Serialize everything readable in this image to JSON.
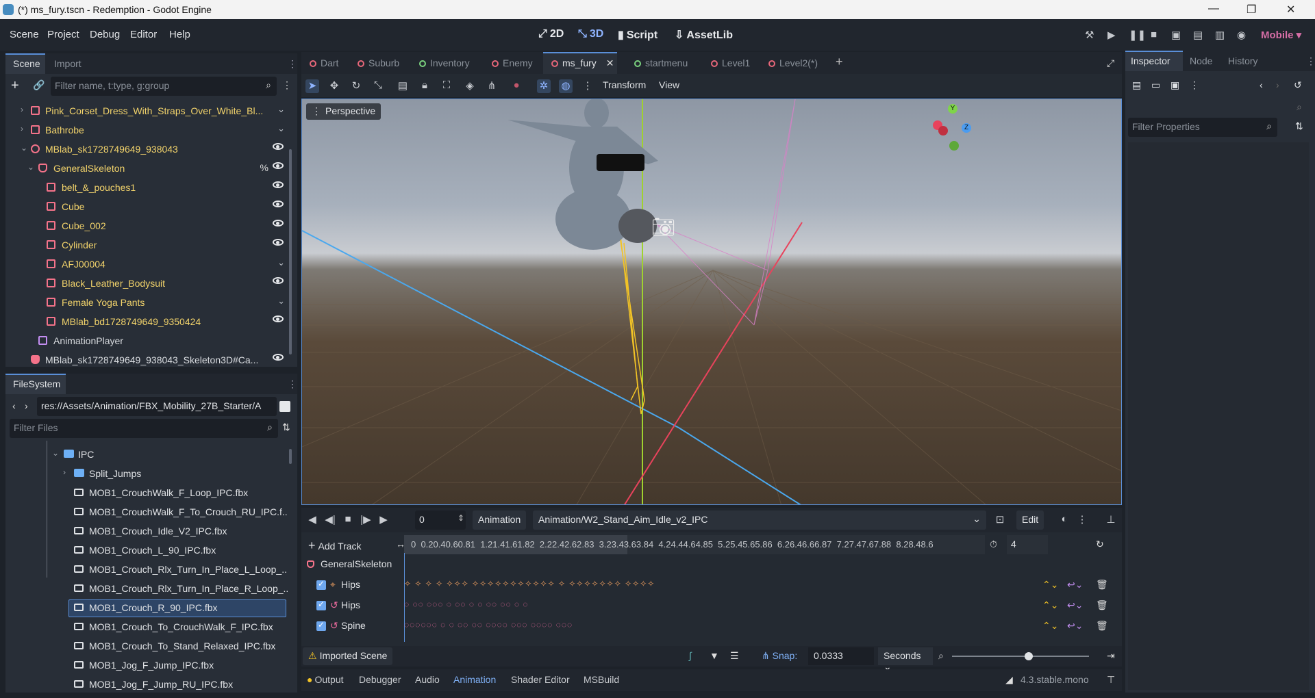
{
  "window": {
    "title": "(*) ms_fury.tscn - Redemption - Godot Engine"
  },
  "menu": {
    "items": [
      "Scene",
      "Project",
      "Debug",
      "Editor",
      "Help"
    ]
  },
  "workspaces": [
    {
      "label": "2D",
      "icon": "⤢"
    },
    {
      "label": "3D",
      "icon": "⤡"
    },
    {
      "label": "Script",
      "icon": "▮"
    },
    {
      "label": "AssetLib",
      "icon": "⇩"
    }
  ],
  "renderer": "Mobile",
  "scene_dock": {
    "tabs": [
      "Scene",
      "Import"
    ],
    "filter_placeholder": "Filter name, t:type, g:group",
    "nodes": [
      {
        "label": "Pink_Corset_Dress_With_Straps_Over_White_Bl...",
        "vis": "hidden"
      },
      {
        "label": "Bathrobe",
        "vis": "hidden"
      },
      {
        "label": "MBlab_sk1728749649_938043",
        "vis": "eye"
      },
      {
        "label": "GeneralSkeleton",
        "vis": "eye",
        "extra": "%"
      },
      {
        "label": "belt_&_pouches1",
        "vis": "eye"
      },
      {
        "label": "Cube",
        "vis": "eye"
      },
      {
        "label": "Cube_002",
        "vis": "eye"
      },
      {
        "label": "Cylinder",
        "vis": "eye"
      },
      {
        "label": "AFJ00004",
        "vis": "hidden"
      },
      {
        "label": "Black_Leather_Bodysuit",
        "vis": "eye"
      },
      {
        "label": "Female Yoga Pants",
        "vis": "hidden"
      },
      {
        "label": "MBlab_bd1728749649_9350424",
        "vis": "eye"
      },
      {
        "label": "AnimationPlayer",
        "vis": "none"
      },
      {
        "label": "MBlab_sk1728749649_938043_Skeleton3D#Ca...",
        "vis": "eye"
      }
    ]
  },
  "filesystem": {
    "tab": "FileSystem",
    "path": "res://Assets/Animation/FBX_Mobility_27B_Starter/A",
    "filter_placeholder": "Filter Files",
    "items": [
      "IPC",
      "Split_Jumps",
      "MOB1_CrouchWalk_F_Loop_IPC.fbx",
      "MOB1_CrouchWalk_F_To_Crouch_RU_IPC.f...",
      "MOB1_Crouch_Idle_V2_IPC.fbx",
      "MOB1_Crouch_L_90_IPC.fbx",
      "MOB1_Crouch_Rlx_Turn_In_Place_L_Loop_...",
      "MOB1_Crouch_Rlx_Turn_In_Place_R_Loop_...",
      "MOB1_Crouch_R_90_IPC.fbx",
      "MOB1_Crouch_To_CrouchWalk_F_IPC.fbx",
      "MOB1_Crouch_To_Stand_Relaxed_IPC.fbx",
      "MOB1_Jog_F_Jump_IPC.fbx",
      "MOB1_Jog_F_Jump_RU_IPC.fbx"
    ],
    "selected": "MOB1_Crouch_R_90_IPC.fbx"
  },
  "scene_tabs": [
    "Dart",
    "Suburb",
    "Inventory",
    "Enemy",
    "ms_fury",
    "startmenu",
    "Level1",
    "Level2(*)"
  ],
  "viewport": {
    "menus": [
      "Transform",
      "View"
    ],
    "perspective": "Perspective",
    "gizmo": {
      "y": "Y",
      "z": "Z"
    }
  },
  "animation": {
    "frame": "0",
    "label": "Animation",
    "current": "Animation/W2_Stand_Aim_Idle_v2_IPC",
    "edit": "Edit",
    "add_track": "Add Track",
    "ruler": "0  0.20.40.60.81  1.21.41.61.82  2.22.42.62.83  3.23.43.63.84  4.24.44.64.85  5.25.45.65.86  6.26.46.66.87  7.27.47.67.88  8.28.48.6",
    "length": "4",
    "group": "GeneralSkeleton",
    "tracks": [
      {
        "name": "Hips",
        "type": "pos"
      },
      {
        "name": "Hips",
        "type": "rot"
      },
      {
        "name": "Spine",
        "type": "rot"
      }
    ],
    "imported": "Imported Scene",
    "snap_label": "Snap:",
    "snap": "0.0333",
    "snap_unit": "Seconds"
  },
  "bottom_tabs": [
    "Output",
    "Debugger",
    "Audio",
    "Animation",
    "Shader Editor",
    "MSBuild"
  ],
  "version": "4.3.stable.mono",
  "inspector": {
    "tabs": [
      "Inspector",
      "Node",
      "History"
    ],
    "filter_placeholder": "Filter Properties"
  }
}
